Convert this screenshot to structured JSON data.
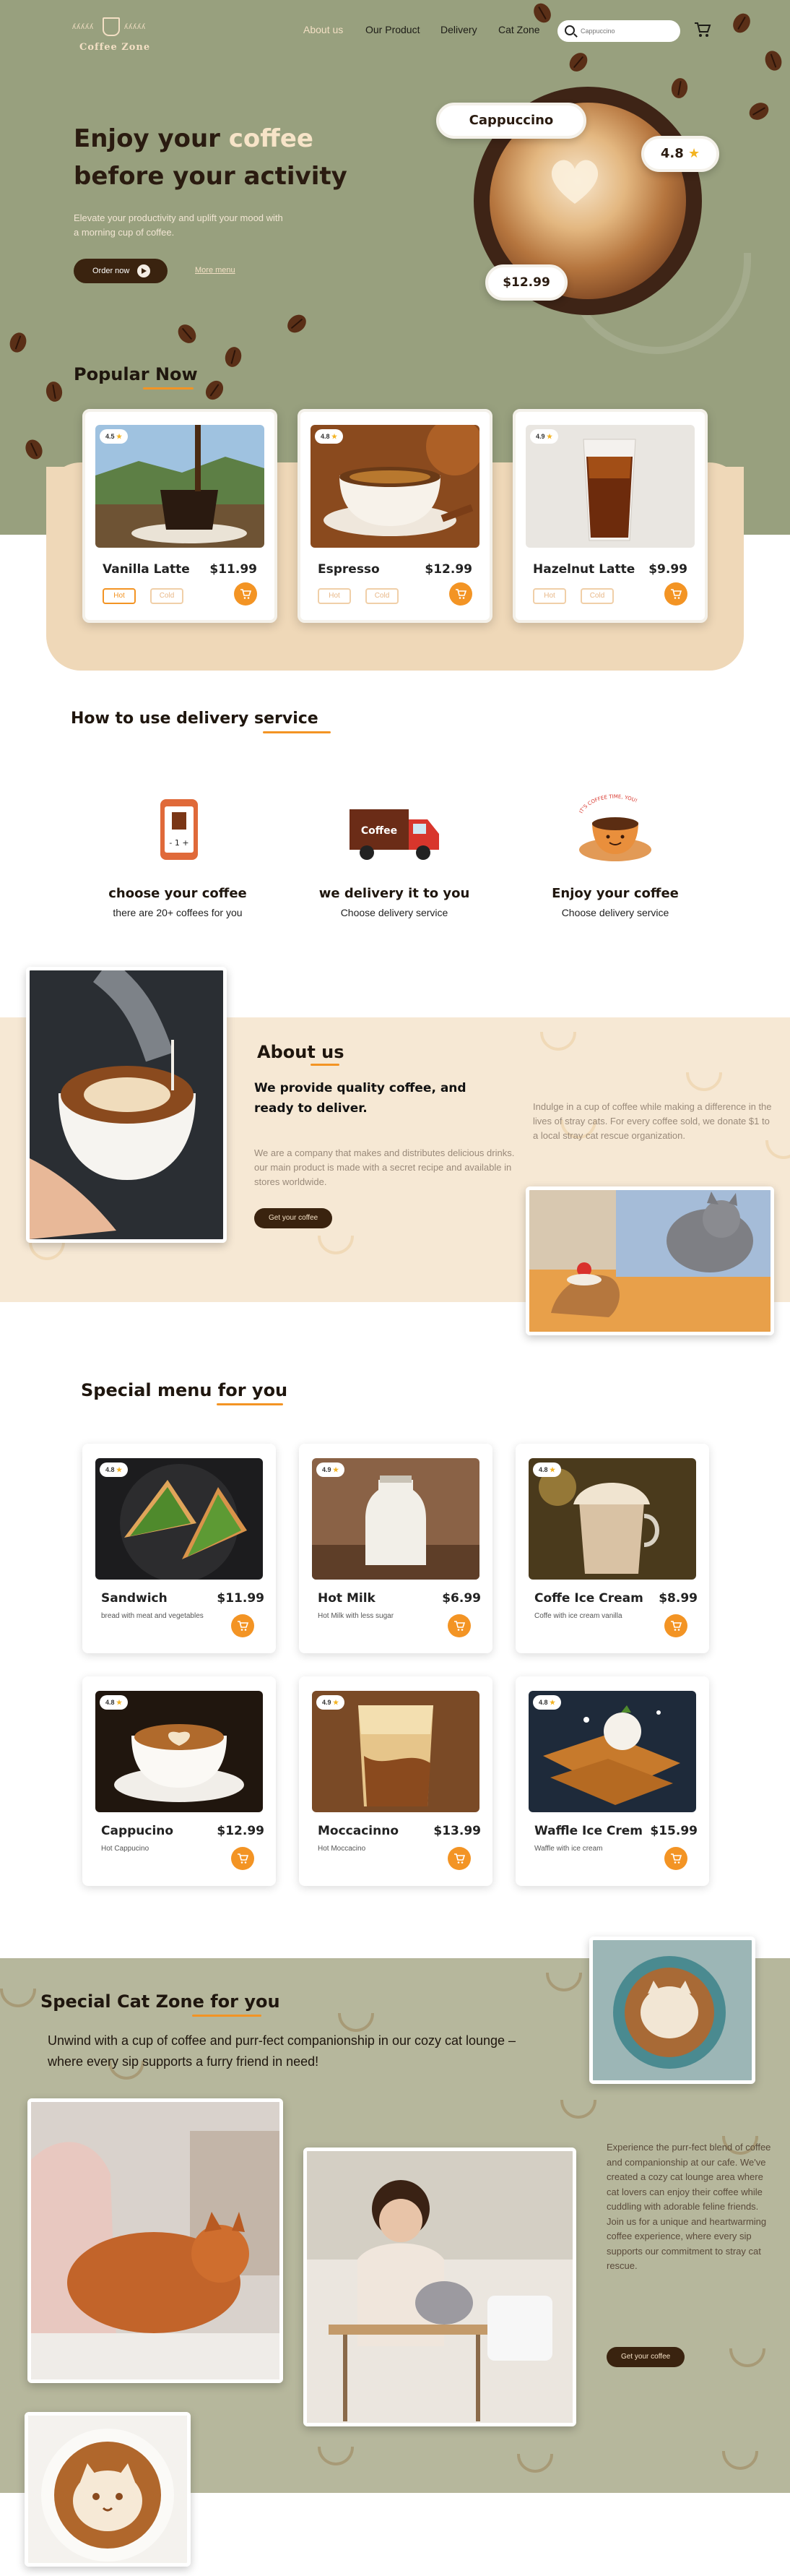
{
  "brand": {
    "name": "Coffee Zone",
    "wing_left": "ʎʎʎʎʎ",
    "wing_right": "ʎʎʎʎʎ"
  },
  "nav": {
    "items": [
      "About us",
      "Our Product",
      "Delivery",
      "Cat Zone"
    ],
    "active": "About us"
  },
  "search": {
    "placeholder": "Cappuccino"
  },
  "hero": {
    "title_part1": "Enjoy your ",
    "title_highlight": "coffee",
    "title_part2": "before your activity",
    "subtitle": "Elevate your productivity and uplift your mood with a morning cup of coffee.",
    "order_button": "Order now",
    "more_link": "More menu",
    "featured_name": "Cappuccino",
    "featured_rating": "4.8",
    "featured_price": "$12.99"
  },
  "popular": {
    "title": "Popular Now",
    "items": [
      {
        "rating": "4.5",
        "name": "Vanilla Latte",
        "price": "$11.99",
        "options": [
          "Hot",
          "Cold"
        ],
        "selected": "Hot"
      },
      {
        "rating": "4.8",
        "name": "Espresso",
        "price": "$12.99",
        "options": [
          "Hot",
          "Cold"
        ],
        "selected": ""
      },
      {
        "rating": "4.9",
        "name": "Hazelnut Latte",
        "price": "$9.99",
        "options": [
          "Hot",
          "Cold"
        ],
        "selected": ""
      }
    ]
  },
  "delivery": {
    "title_part1": "How to use delivery ",
    "title_highlight": "service",
    "steps": [
      {
        "icon": "phone-order-icon",
        "title": "choose your coffee",
        "subtitle": "there are 20+ coffees for you",
        "phone_text": "- 1 +"
      },
      {
        "icon": "delivery-truck-icon",
        "title": "we delivery it to you",
        "subtitle": "Choose delivery service",
        "truck_text": "Coffee"
      },
      {
        "icon": "coffee-cup-mascot-icon",
        "title": "Enjoy your coffee",
        "subtitle": "Choose delivery service",
        "arc_text": "IT'S COFFEE TIME, YOU!"
      }
    ]
  },
  "about": {
    "title": "About us",
    "headline": "We provide quality coffee, and ready to deliver.",
    "body": "We are a company that makes and distributes delicious drinks. our main product is made with a secret recipe and available in stores worldwide.",
    "button": "Get your coffee",
    "side_text": "Indulge in a cup of coffee while making a difference in the lives of stray cats. For every coffee sold, we donate $1 to a local stray cat rescue organization."
  },
  "menu": {
    "title_part1": "Special menu ",
    "title_highlight": "for you",
    "items": [
      {
        "rating": "4.8",
        "name": "Sandwich",
        "price": "$11.99",
        "desc": "bread with meat and vegetables"
      },
      {
        "rating": "4.9",
        "name": "Hot Milk",
        "price": "$6.99",
        "desc": "Hot Milk with less sugar"
      },
      {
        "rating": "4.8",
        "name": "Coffe Ice Cream",
        "price": "$8.99",
        "desc": "Coffe with ice cream vanilla"
      },
      {
        "rating": "4.8",
        "name": "Cappucino",
        "price": "$12.99",
        "desc": "Hot Cappucino"
      },
      {
        "rating": "4.9",
        "name": "Moccacinno",
        "price": "$13.99",
        "desc": "Hot Moccacino"
      },
      {
        "rating": "4.8",
        "name": "Waffle Ice Crem",
        "price": "$15.99",
        "desc": "Waffle with ice cream"
      }
    ]
  },
  "catzone": {
    "title_part1": "Special Cat Zone ",
    "title_highlight": "for you",
    "lead": "Unwind with a cup of coffee and purr-fect companionship in our cozy cat lounge – where every sip supports a furry friend in need!",
    "body": "Experience the purr-fect blend of coffee and companionship at our cafe. We've created a cozy cat lounge area where cat lovers can enjoy their coffee while cuddling with adorable feline friends. Join us for a unique and heartwarming coffee experience, where every sip supports our commitment to stray cat rescue.",
    "button": "Get your coffee"
  },
  "colors": {
    "accent": "#f39424",
    "olive": "#98a07e",
    "dark_brown": "#3a230f",
    "cream": "#f6e8d4",
    "sage": "#b6b79c"
  }
}
